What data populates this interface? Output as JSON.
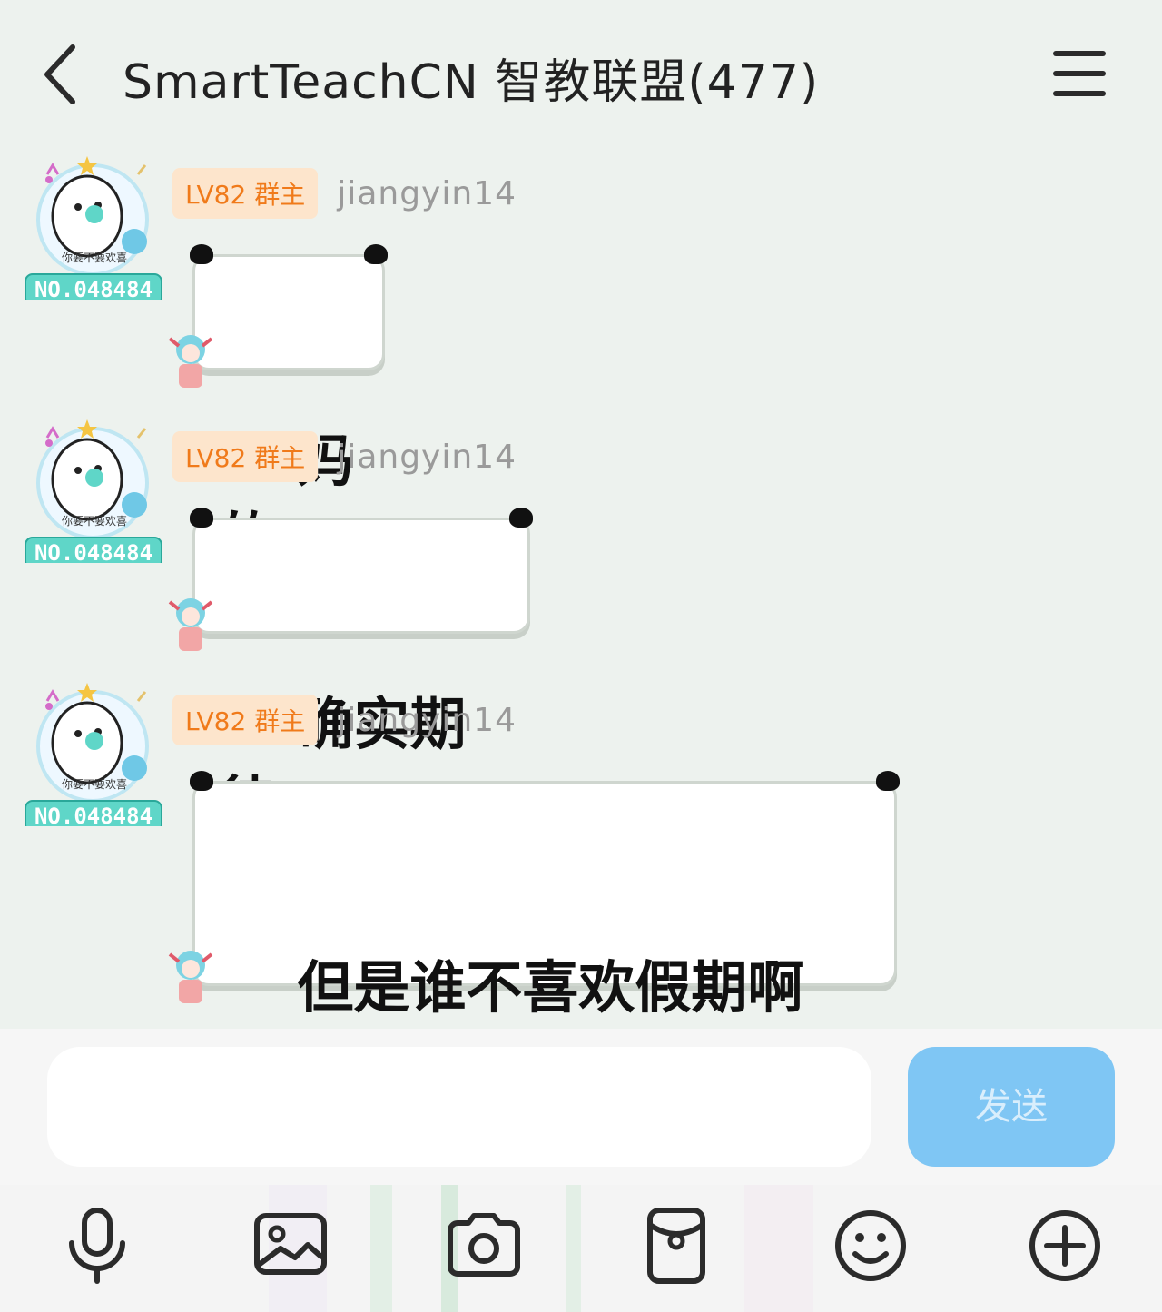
{
  "header": {
    "back_icon": "chevron-left-icon",
    "title": "SmartTeachCN 智教联盟(477)",
    "menu_icon": "hamburger-menu-icon"
  },
  "avatar": {
    "tag": "NO.048484",
    "caption": "你要不要欢喜"
  },
  "messages": [
    {
      "level": "LV82",
      "role": "群主",
      "badge": "LV82 群主",
      "username": "jiangyin14",
      "text": "妈的"
    },
    {
      "level": "LV82",
      "role": "群主",
      "badge": "LV82 群主",
      "username": "jiangyin14",
      "text": "确实期待"
    },
    {
      "level": "LV82",
      "role": "群主",
      "badge": "LV82 群主",
      "username": "jiangyin14",
      "text": "但是谁不喜欢假期啊\n（"
    }
  ],
  "composer": {
    "input_value": "",
    "send_label": "发送"
  },
  "toolbar": {
    "items": [
      "microphone-icon",
      "image-icon",
      "camera-icon",
      "red-packet-icon",
      "emoji-icon",
      "plus-icon"
    ]
  },
  "colors": {
    "background": "#edf2ee",
    "badge_bg": "#fde5cc",
    "badge_text": "#f07a1a",
    "send_button": "#7fc6f4",
    "avatar_tag": "#5fd6c8"
  }
}
